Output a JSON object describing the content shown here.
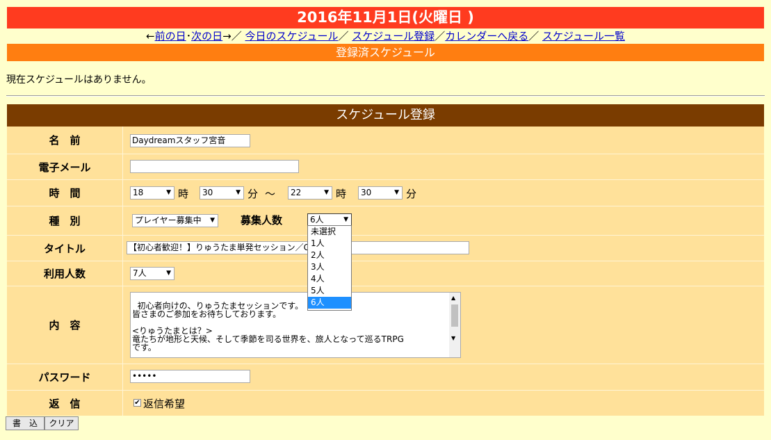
{
  "header": {
    "date_title": "2016年11月1日(火曜日 )",
    "nav": {
      "prev_arrow": "←",
      "prev_day": "前の日",
      "dot": "･",
      "next_day": "次の日",
      "next_arrow": "→",
      "slash1": "／",
      "today_schedule": "今日のスケジュール",
      "slash2": "／",
      "schedule_register": "スケジュール登録",
      "slash3": "／",
      "back_to_calendar": "カレンダーへ戻る",
      "slash4": "／",
      "schedule_list": "スケジュール一覧"
    },
    "registered_title": "登録済スケジュール"
  },
  "registered": {
    "empty_message": "現在スケジュールはありません。"
  },
  "form": {
    "title": "スケジュール登録",
    "name_label": "名　前",
    "name_value": "Daydreamスタッフ宮音",
    "email_label": "電子メール",
    "email_value": "",
    "time_label": "時　間",
    "start_hour": "18",
    "hour_unit": "時",
    "start_min": "30",
    "min_unit": "分",
    "tilde": "～",
    "end_hour": "22",
    "end_min": "30",
    "type_label": "種　別",
    "type_value": "プレイヤー募集中",
    "recruit_label": "募集人数",
    "recruit_value": "6人",
    "recruit_options": [
      "未選択",
      "1人",
      "2人",
      "3人",
      "4人",
      "5人",
      "6人"
    ],
    "title_label": "タイトル",
    "title_value": "【初心者歓迎！】りゅうたま単発セッション／G",
    "users_label": "利用人数",
    "users_value": "7人",
    "content_label": "内　容",
    "content_value": "初心者向けの、りゅうたまセッションです。\n皆さまのご参加をお待ちしております。\n\n<りゅうたまとは？>\n竜たちが地形と天候、そして季節を司る世界を、旅人となって巡るTRPG\nです。",
    "password_label": "パスワード",
    "password_value": "•••••",
    "reply_label": "返　信",
    "reply_checkbox_label": "返信希望",
    "reply_checked": true
  },
  "buttons": {
    "submit": "書　込",
    "clear": "クリア"
  },
  "colors": {
    "date_bar": "#ff3b1f",
    "registered_bar": "#ff7e11",
    "form_header": "#7a3c00",
    "form_body": "#ffe19a",
    "page_bg": "#ffffcc",
    "selected_option": "#1e90ff"
  }
}
